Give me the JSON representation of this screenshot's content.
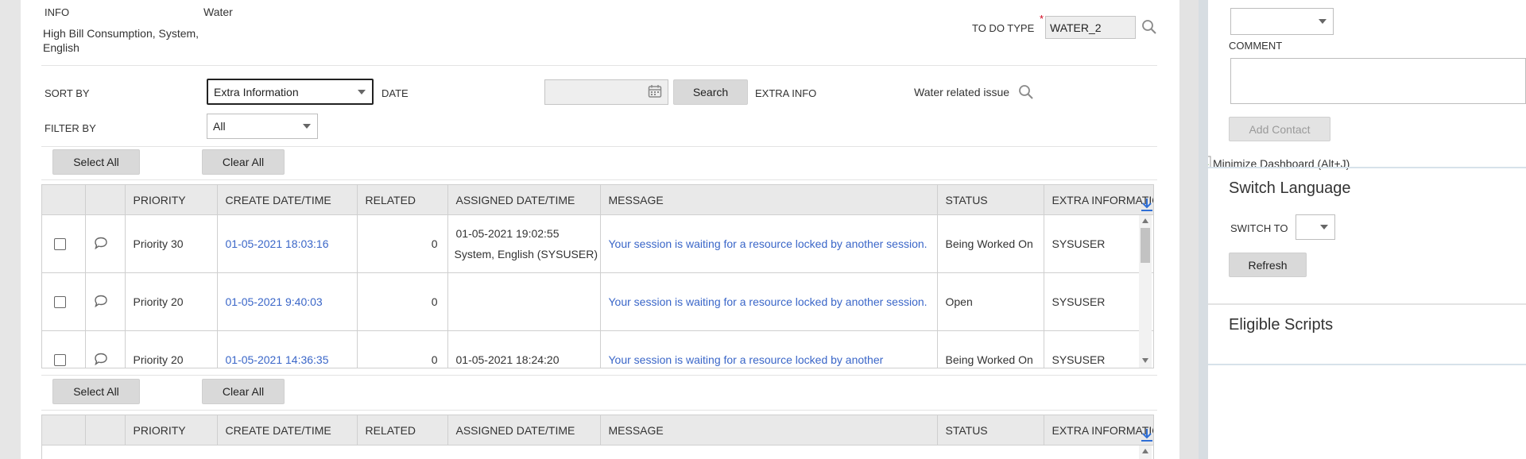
{
  "header": {
    "info_label": "INFO",
    "info_value_line1": "High Bill Consumption, System,",
    "info_value_line2": "English",
    "category_value": "Water",
    "todo_type_label": "TO DO TYPE",
    "todo_type_required": "*",
    "todo_type_value": "WATER_2"
  },
  "filters": {
    "sort_by_label": "SORT BY",
    "sort_by_value": "Extra Information",
    "date_label": "DATE",
    "date_value": "",
    "search_button": "Search",
    "extra_info_label": "EXTRA INFO",
    "extra_info_value": "Water related issue",
    "filter_by_label": "FILTER BY",
    "filter_by_value": "All"
  },
  "actions": {
    "select_all": "Select All",
    "clear_all": "Clear All"
  },
  "grid": {
    "columns": [
      "",
      "",
      "PRIORITY",
      "CREATE DATE/TIME",
      "RELATED",
      "ASSIGNED DATE/TIME",
      "MESSAGE",
      "STATUS",
      "EXTRA INFORMATION"
    ],
    "rows": [
      {
        "priority": "Priority 30",
        "create_datetime": "01-05-2021 18:03:16",
        "related": "0",
        "assigned_line1": "01-05-2021 19:02:55",
        "assigned_line2": "System, English (SYSUSER)",
        "message": "Your session is waiting for a resource locked by another session.",
        "status": "Being Worked On",
        "extra_information": "SYSUSER"
      },
      {
        "priority": "Priority 20",
        "create_datetime": "01-05-2021 9:40:03",
        "related": "0",
        "assigned_line1": "",
        "assigned_line2": "",
        "message": "Your session is waiting for a resource locked by another session.",
        "status": "Open",
        "extra_information": "SYSUSER"
      },
      {
        "priority": "Priority 20",
        "create_datetime": "01-05-2021 14:36:35",
        "related": "0",
        "assigned_line1": "01-05-2021 18:24:20",
        "assigned_line2": "",
        "message": "Your session is waiting for a resource locked by another",
        "status": "Being Worked On",
        "extra_information": "SYSUSER"
      }
    ]
  },
  "side_panel": {
    "type_value": "",
    "comment_label": "COMMENT",
    "comment_value": "",
    "add_contact_button": "Add Contact",
    "minimize_dashboard": "Minimize Dashboard (Alt+J)",
    "switch_language_title": "Switch Language",
    "switch_to_label": "SWITCH TO",
    "switch_to_value": "",
    "refresh_button": "Refresh",
    "eligible_scripts_title": "Eligible Scripts"
  },
  "icons": {
    "search": "search-icon",
    "calendar": "calendar-icon",
    "comment": "speech-bubble-icon",
    "download": "download-icon",
    "broken_image": "broken-image-icon"
  },
  "colors": {
    "link": "#3a66c8",
    "header_bg": "#e9e9e9",
    "button_bg": "#d9d9d9",
    "page_bg": "#e6e6e6",
    "required": "#d0021b"
  }
}
